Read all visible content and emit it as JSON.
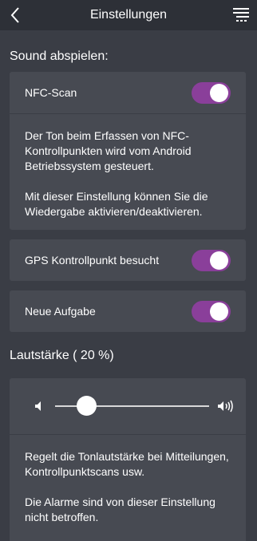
{
  "header": {
    "title": "Einstellungen",
    "back_icon": "chevron-left-icon",
    "menu_icon": "menu-icon"
  },
  "sound": {
    "section_title": "Sound abspielen:",
    "nfc": {
      "label": "NFC-Scan",
      "enabled": true,
      "desc1": "Der Ton beim Erfassen von NFC-Kontrollpunkten wird vom Android Betriebssystem gesteuert.",
      "desc2": "Mit dieser Einstellung können Sie die Wiedergabe aktivieren/deaktivieren."
    },
    "gps": {
      "label": "GPS Kontrollpunkt besucht",
      "enabled": true
    },
    "task": {
      "label": "Neue Aufgabe",
      "enabled": true
    }
  },
  "volume": {
    "section_title": "Lautstärke ( 20 %)",
    "percent": 20,
    "desc1": "Regelt die Tonlautstärke bei Mitteilungen, Kontrollpunktscans usw.",
    "desc2": "Die Alarme sind von dieser Einstellung nicht betroffen."
  },
  "colors": {
    "background": "#3a3d45",
    "header": "#2d3037",
    "card": "#474a52",
    "toggle_on": "#8a3f9a"
  }
}
